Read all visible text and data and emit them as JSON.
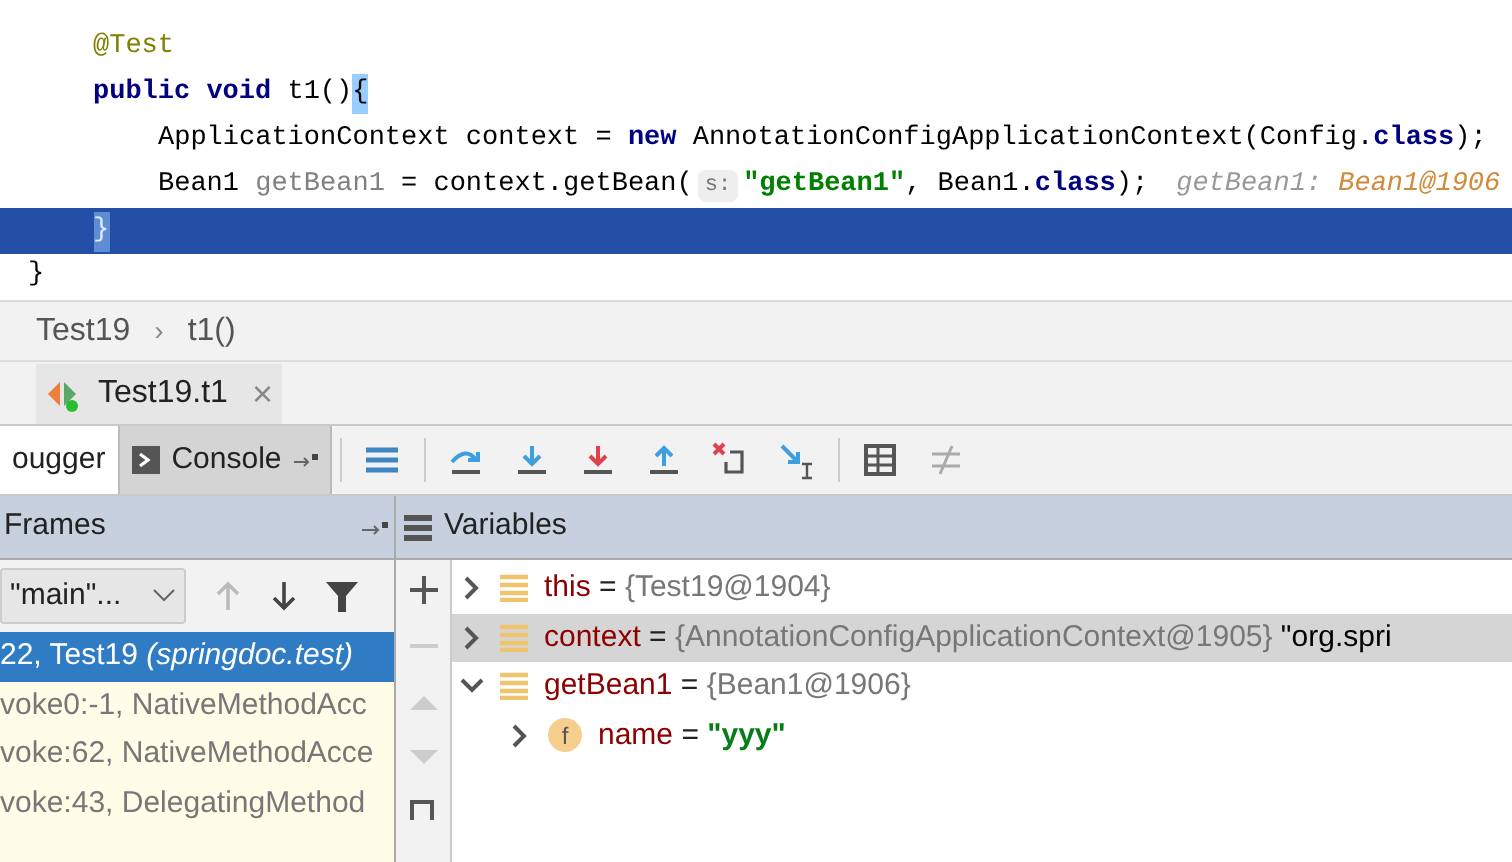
{
  "editor": {
    "lines": [
      {
        "children": [
          {
            "current": false,
            "tokens": [
              {
                "kind": "annotation",
                "text": "@Test"
              }
            ]
          },
          {
            "current": false,
            "tokens": [
              {
                "kind": "keyword",
                "text": "public void "
              },
              {
                "kind": "plain",
                "text": "t1()"
              },
              {
                "kind": "brace",
                "text": "{"
              }
            ],
            "children": [
              {
                "current": false,
                "tokens": [
                  {
                    "kind": "plain",
                    "text": "ApplicationContext context = "
                  },
                  {
                    "kind": "keyword",
                    "text": "new "
                  },
                  {
                    "kind": "plain",
                    "text": "AnnotationConfigApplicationContext(Config."
                  },
                  {
                    "kind": "keyword",
                    "text": "class"
                  },
                  {
                    "kind": "plain",
                    "text": ");"
                  }
                ]
              },
              {
                "current": false,
                "tokens": [
                  {
                    "kind": "plain",
                    "text": "Bean1 "
                  },
                  {
                    "kind": "unused",
                    "text": "getBean1"
                  },
                  {
                    "kind": "plain",
                    "text": " = context.getBean("
                  },
                  {
                    "kind": "param",
                    "text": "s:"
                  },
                  {
                    "kind": "string",
                    "text": "\"getBean1\""
                  },
                  {
                    "kind": "plain",
                    "text": ", Bean1."
                  },
                  {
                    "kind": "keyword",
                    "text": "class"
                  },
                  {
                    "kind": "plain",
                    "text": ");"
                  },
                  {
                    "kind": "hint",
                    "text": "getBean1: "
                  },
                  {
                    "kind": "value",
                    "text": "Bean1@1906"
                  }
                ]
              }
            ]
          },
          {
            "current": true,
            "tokens": [
              {
                "kind": "brace",
                "text": "}"
              }
            ]
          }
        ]
      },
      {
        "current": false,
        "tokens": [
          {
            "kind": "plain",
            "text": "}"
          }
        ]
      }
    ]
  },
  "breadcrumbs": {
    "separator": "›",
    "items": [
      "Test19",
      "t1()"
    ]
  },
  "run_tab": {
    "label": "Test19.t1",
    "close": "×"
  },
  "debug_tabs": [
    {
      "label": "ougger",
      "selected": true
    },
    {
      "label": "Console",
      "selected": false
    }
  ],
  "frames": {
    "title": "Frames",
    "thread": "\"main\"...",
    "items": [
      {
        "location": "22, Test19",
        "package": " (springdoc.test)",
        "selected": true
      },
      {
        "location": "voke0:-1, NativeMethodAcc",
        "selected": false
      },
      {
        "location": "voke:62, NativeMethodAcce",
        "selected": false
      },
      {
        "location": "voke:43, DelegatingMethod",
        "selected": false
      }
    ]
  },
  "variables": {
    "title": "Variables",
    "items": [
      {
        "kind": "local",
        "name": "this",
        "equals": " = ",
        "value": "{Test19@1904}",
        "expanded": false,
        "selected": false
      },
      {
        "kind": "local",
        "name": "context",
        "equals": " = ",
        "value": "{AnnotationConfigApplicationContext@1905}",
        "extra": " \"org.spri",
        "expanded": false,
        "selected": true
      },
      {
        "kind": "local",
        "name": "getBean1",
        "equals": " = ",
        "value": "{Bean1@1906}",
        "expanded": true,
        "selected": false,
        "children": [
          {
            "kind": "field",
            "icon_letter": "f",
            "name": "name",
            "equals": " = ",
            "string": "\"yyy\"",
            "expanded": false,
            "selected": false
          }
        ]
      }
    ]
  }
}
